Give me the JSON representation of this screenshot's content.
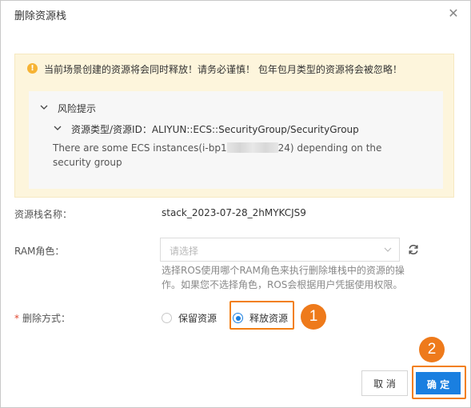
{
  "dialog": {
    "title": "删除资源栈",
    "close_icon": "close-icon"
  },
  "warning": {
    "icon": "warning-icon",
    "text": "当前场景创建的资源将会同时释放！请务必谨慎！ 包年包月类型的资源将会被忽略！",
    "risk": {
      "title": "风险提示",
      "resource_line": "资源类型/资源ID：ALIYUN::ECS::SecurityGroup/SecurityGroup",
      "description_before": "There are some ECS instances(i-bp1",
      "description_after": "24) depending on the security group"
    }
  },
  "form": {
    "stack_name_label": "资源栈名称：",
    "stack_name_value": "stack_2023-07-28_2hMYKCJS9",
    "ram_role_label": "RAM角色：",
    "ram_role_placeholder": "请选择",
    "ram_role_help": "选择ROS使用哪个RAM角色来执行删除堆栈中的资源的操作。如果您不选择角色，ROS会根据用户凭据使用权限。",
    "delete_method_required": "*",
    "delete_method_label": "删除方式：",
    "options": [
      {
        "label": "保留资源",
        "selected": false
      },
      {
        "label": "释放资源",
        "selected": true
      }
    ]
  },
  "annotations": {
    "step1": "1",
    "step2": "2",
    "color": "#ee7a1b"
  },
  "buttons": {
    "cancel": "取 消",
    "ok": "确 定"
  },
  "colors": {
    "primary": "#1a7fe0",
    "warning_bg": "#fdf5dc",
    "warning_icon": "#f6b334"
  }
}
